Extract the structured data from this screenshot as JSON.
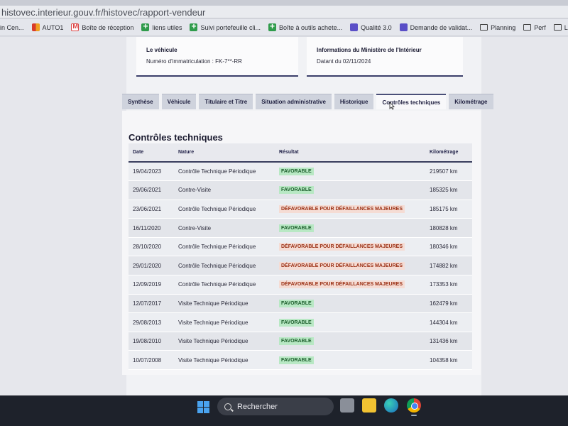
{
  "browser": {
    "url": "histovec.interieur.gouv.fr/histovec/rapport-vendeur",
    "bookmarks": [
      {
        "label": "in Cen...",
        "icon": "none"
      },
      {
        "label": "AUTO1",
        "icon": "auto"
      },
      {
        "label": "Boîte de réception",
        "icon": "gmail"
      },
      {
        "label": "liens utiles",
        "icon": "plus"
      },
      {
        "label": "Suivi portefeuille cli...",
        "icon": "plus"
      },
      {
        "label": "Boîte à outils achete...",
        "icon": "plus"
      },
      {
        "label": "Qualité 3.0",
        "icon": "form"
      },
      {
        "label": "Demande de validat...",
        "icon": "form"
      },
      {
        "label": "Planning",
        "icon": "folder"
      },
      {
        "label": "Perf",
        "icon": "folder"
      },
      {
        "label": "Livraison AH",
        "icon": "folder"
      }
    ]
  },
  "cards": {
    "vehicule": {
      "title": "Le véhicule",
      "value": "Numéro d'immatriculation : FK-7**-RR"
    },
    "ministere": {
      "title": "Informations du Ministère de l'Intérieur",
      "value": "Datant du 02/11/2024"
    }
  },
  "tabs": [
    {
      "label": "Synthèse",
      "active": false
    },
    {
      "label": "Véhicule",
      "active": false
    },
    {
      "label": "Titulaire et Titre",
      "active": false
    },
    {
      "label": "Situation administrative",
      "active": false
    },
    {
      "label": "Historique",
      "active": false
    },
    {
      "label": "Contrôles techniques",
      "active": true
    },
    {
      "label": "Kilométrage",
      "active": false
    }
  ],
  "section_title": "Contrôles techniques",
  "table": {
    "headers": [
      "Date",
      "Nature",
      "Résultat",
      "Kilométrage"
    ],
    "rows": [
      {
        "date": "19/04/2023",
        "nature": "Contrôle Technique Périodique",
        "result": "FAVORABLE",
        "status": "fav",
        "km": "219507 km"
      },
      {
        "date": "29/06/2021",
        "nature": "Contre-Visite",
        "result": "FAVORABLE",
        "status": "fav",
        "km": "185325 km"
      },
      {
        "date": "23/06/2021",
        "nature": "Contrôle Technique Périodique",
        "result": "DÉFAVORABLE POUR DÉFAILLANCES MAJEURES",
        "status": "defav",
        "km": "185175 km"
      },
      {
        "date": "16/11/2020",
        "nature": "Contre-Visite",
        "result": "FAVORABLE",
        "status": "fav",
        "km": "180828 km"
      },
      {
        "date": "28/10/2020",
        "nature": "Contrôle Technique Périodique",
        "result": "DÉFAVORABLE POUR DÉFAILLANCES MAJEURES",
        "status": "defav",
        "km": "180346 km"
      },
      {
        "date": "29/01/2020",
        "nature": "Contrôle Technique Périodique",
        "result": "DÉFAVORABLE POUR DÉFAILLANCES MAJEURES",
        "status": "defav",
        "km": "174882 km"
      },
      {
        "date": "12/09/2019",
        "nature": "Contrôle Technique Périodique",
        "result": "DÉFAVORABLE POUR DÉFAILLANCES MAJEURES",
        "status": "defav",
        "km": "173353 km"
      },
      {
        "date": "12/07/2017",
        "nature": "Visite Technique Périodique",
        "result": "FAVORABLE",
        "status": "fav",
        "km": "162479 km"
      },
      {
        "date": "29/08/2013",
        "nature": "Visite Technique Périodique",
        "result": "FAVORABLE",
        "status": "fav",
        "km": "144304 km"
      },
      {
        "date": "19/08/2010",
        "nature": "Visite Technique Périodique",
        "result": "FAVORABLE",
        "status": "fav",
        "km": "131436 km"
      },
      {
        "date": "10/07/2008",
        "nature": "Visite Technique Périodique",
        "result": "FAVORABLE",
        "status": "fav",
        "km": "104358 km"
      }
    ]
  },
  "taskbar": {
    "search_label": "Rechercher",
    "icons": [
      "windows-start-icon",
      "task-view-icon",
      "file-explorer-icon",
      "edge-icon",
      "chrome-icon"
    ]
  },
  "colors": {
    "favorable_bg": "#b8e8c4",
    "defavorable_bg": "#f5dcd4",
    "accent": "#3b3f6a"
  }
}
